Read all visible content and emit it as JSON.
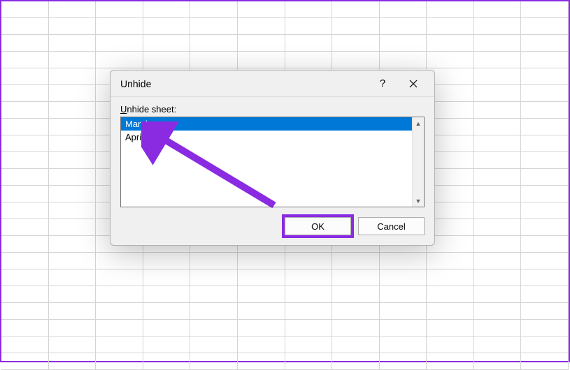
{
  "dialog": {
    "title": "Unhide",
    "label_prefix": "U",
    "label_rest": "nhide sheet:",
    "help": "?",
    "items": [
      {
        "label": "March",
        "selected": true
      },
      {
        "label": "April",
        "selected": false
      }
    ],
    "ok": "OK",
    "cancel": "Cancel"
  },
  "annotation": {
    "arrow_color": "#8a2be2"
  }
}
